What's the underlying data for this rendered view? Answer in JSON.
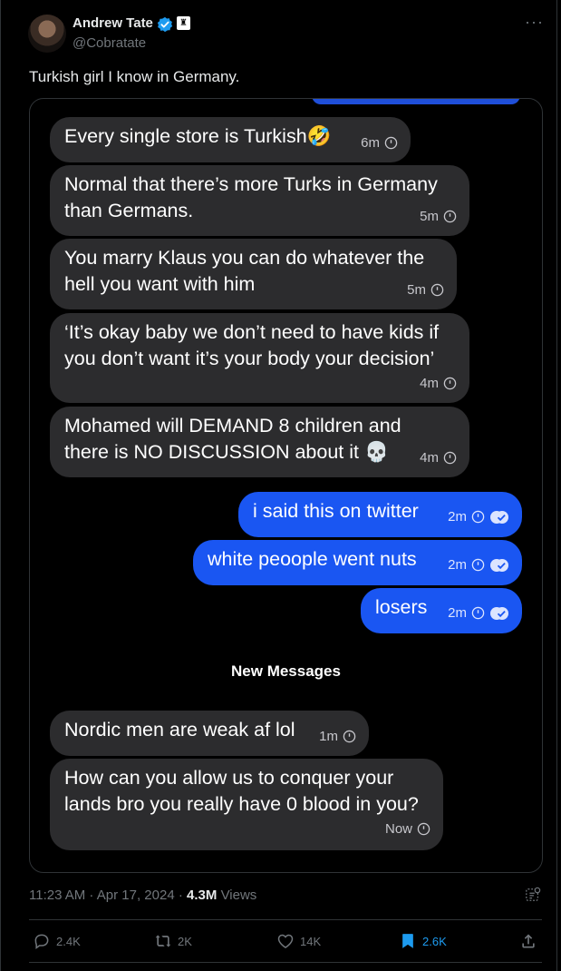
{
  "author": {
    "name": "Andrew Tate",
    "handle": "@Cobratate",
    "verified_color": "#1d9bf0",
    "affiliation_badge": "♜"
  },
  "tweet_text": "Turkish girl I know in Germany.",
  "chat": {
    "messages": [
      {
        "dir": "in",
        "lines": [
          "Every single store is Turkish🤣"
        ],
        "time": "6m"
      },
      {
        "dir": "in",
        "lines": [
          "Normal that there’s more Turks in Germany",
          "than Germans."
        ],
        "time": "5m"
      },
      {
        "dir": "in",
        "lines": [
          "You marry Klaus you can do whatever the",
          "hell you want with him"
        ],
        "time": "5m"
      },
      {
        "dir": "in",
        "lines": [
          "‘It’s okay baby we don’t need to have kids if",
          "you don’t want it’s your body your decision’"
        ],
        "time": "4m"
      },
      {
        "dir": "in",
        "lines": [
          "Mohamed will DEMAND 8 children and",
          "there is NO DISCUSSION about it 💀"
        ],
        "time": "4m"
      },
      {
        "dir": "out",
        "lines": [
          "i said this on twitter"
        ],
        "time": "2m"
      },
      {
        "dir": "out",
        "lines": [
          "white peoople went nuts"
        ],
        "time": "2m"
      },
      {
        "dir": "out",
        "lines": [
          "losers"
        ],
        "time": "2m"
      },
      {
        "dir": "in",
        "lines": [
          "Nordic men are weak af lol"
        ],
        "time": "1m"
      },
      {
        "dir": "in",
        "lines": [
          "How can you allow us to conquer your",
          "lands bro you really have 0 blood in you?"
        ],
        "time": "Now"
      }
    ],
    "new_messages_label": "New Messages"
  },
  "footer": {
    "time": "11:23 AM",
    "date": "Apr 17, 2024",
    "views_count": "4.3M",
    "views_label": "Views"
  },
  "actions": {
    "replies": "2.4K",
    "reposts": "2K",
    "likes": "14K",
    "bookmarks": "2.6K"
  },
  "colors": {
    "incoming_bubble": "#2c2c2e",
    "outgoing_bubble": "#1a56f2",
    "accent": "#1d9bf0"
  }
}
